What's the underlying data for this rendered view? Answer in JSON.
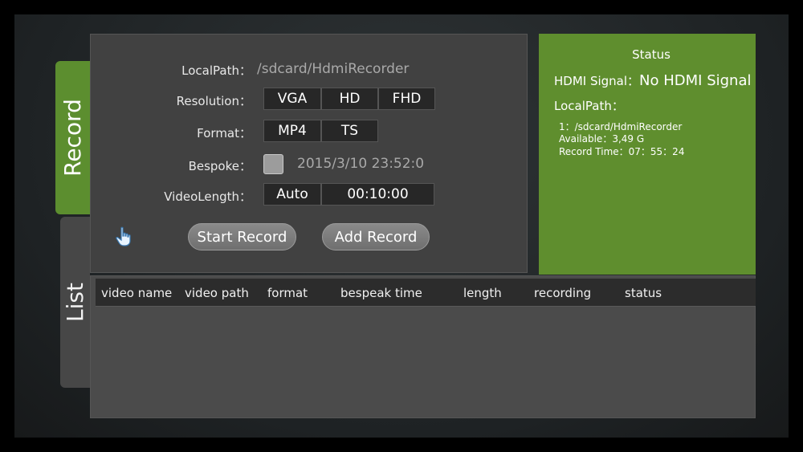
{
  "tabs": {
    "record": "Record",
    "list": "List"
  },
  "form": {
    "localpath_label": "LocalPath：",
    "localpath_value": "/sdcard/HdmiRecorder",
    "resolution_label": "Resolution：",
    "resolution_options": [
      "VGA",
      "HD",
      "FHD"
    ],
    "format_label": "Format：",
    "format_options": [
      "MP4",
      "TS"
    ],
    "bespoke_label": "Bespoke：",
    "bespoke_datetime": "2015/3/10 23:52:0",
    "videolength_label": "VideoLength：",
    "videolength_mode": "Auto",
    "videolength_value": "00:10:00"
  },
  "buttons": {
    "start_record": "Start Record",
    "add_record": "Add Record"
  },
  "status": {
    "title": "Status",
    "hdmi_label": "HDMI Signal：",
    "hdmi_value": "No HDMI Signal",
    "localpath_label": "LocalPath：",
    "path_line": "1：/sdcard/HdmiRecorder",
    "available_line": "Available：3,49 G",
    "record_time_line": "Record Time：07：55：24"
  },
  "list": {
    "columns": [
      "video name",
      "video path",
      "format",
      "bespeak time",
      "length",
      "recording",
      "status"
    ]
  },
  "colors": {
    "accent": "#5f8e2e",
    "panel": "#414141",
    "button": "#272727"
  },
  "icons": {
    "cursor": "hand-pointer-icon"
  }
}
